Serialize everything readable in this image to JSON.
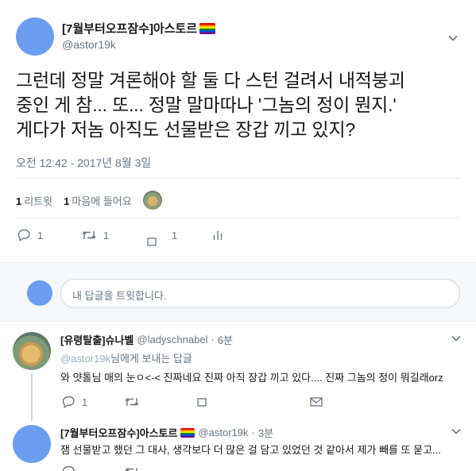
{
  "tweet": {
    "display_name": "[7월부터오프잠수]아스토르",
    "handle": "@astor19k",
    "text_line1": "그런데 정말 겨론해야 할 둘 다 스턴 걸려서 내적붕괴",
    "text_line2": "중인 게 참... 또... 정말 말마따나 '그놈의 정이 뭔지.'",
    "text_line3": "게다가 저놈 아직도 선물받은 장갑 끼고 있지?",
    "timestamp": "오전 12:42 - 2017년 8월 3일",
    "retweets_count": "1",
    "retweets_label": "리트윗",
    "likes_count": "1",
    "likes_label": "마음에 들어요",
    "action_reply_count": "1",
    "action_retweet_count": "1",
    "action_like_count": "1"
  },
  "reply_box": {
    "placeholder": "내 답글을 트윗합니다."
  },
  "replies": [
    {
      "display_name": "[유령탈출]슈나벨",
      "handle": "@ladyschnabel",
      "time": "6분",
      "replying_to_handle": "@astor19k",
      "replying_to_suffix": "님에게 보내는 답글",
      "text": "와 얏톨님 매의 눈ㅇ<-< 진짜네요 진짜 아직 장갑 끼고 있다.... 진짜 그놈의 정이 뭐길래orz",
      "reply_count": "1",
      "retweet_count": "",
      "like_count": ""
    },
    {
      "display_name": "[7월부터오프잠수]아스토르",
      "handle": "@astor19k",
      "time": "3분",
      "text": "잼 선물받고 했던 그 대사, 생각보다 더 많은 걸 담고 있었던 것 같아서 제가 빼를 또 묻고..."
    }
  ],
  "meta_separator": "·",
  "colors": {
    "avatar_blue": "#6b9ef0",
    "text_primary": "#14171a",
    "text_secondary": "#657786",
    "divider": "#e6ecf0",
    "reply_area_bg": "#f5f8fa"
  },
  "icons": {
    "more": "chevron-down-icon",
    "reply": "speech-bubble-icon",
    "retweet": "retweet-arrows-icon",
    "like": "heart-square-icon",
    "analytics": "bar-chart-icon",
    "dm": "envelope-icon",
    "pride_flag": "rainbow-flag-icon"
  }
}
